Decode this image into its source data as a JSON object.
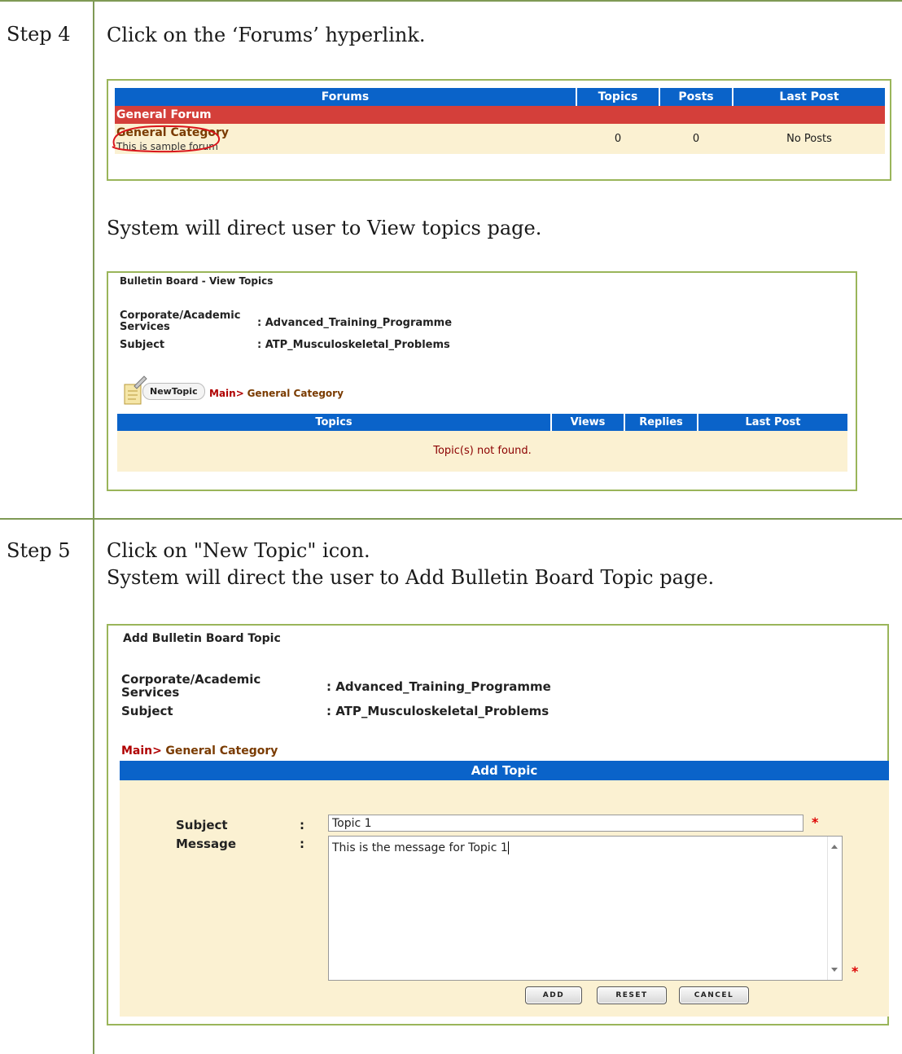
{
  "step4": {
    "label": "Step 4",
    "instruction": "Click on the ‘Forums’ hyperlink.",
    "result_text": "System will direct user to View topics page."
  },
  "forums_table": {
    "headers": [
      "Forums",
      "Topics",
      "Posts",
      "Last Post"
    ],
    "group_row": "General Forum",
    "row": {
      "name": "General Category",
      "description": "This is sample forum",
      "topics": "0",
      "posts": "0",
      "last_post": "No Posts"
    }
  },
  "view_topics": {
    "title": "Bulletin Board - View Topics",
    "meta": [
      {
        "label": "Corporate/Academic Services",
        "value": ": Advanced_Training_Programme"
      },
      {
        "label": "Subject",
        "value": ": ATP_Musculoskeletal_Problems"
      }
    ],
    "new_topic_label": "NewTopic",
    "breadcrumb_main": "Main>",
    "breadcrumb_category": "General Category",
    "headers": [
      "Topics",
      "Views",
      "Replies",
      "Last Post"
    ],
    "empty_message": "Topic(s) not found."
  },
  "step5": {
    "label": "Step 5",
    "instruction_line1": "Click on \"New Topic\" icon.",
    "instruction_line2": "System will direct the user to Add Bulletin Board Topic page."
  },
  "add_topic": {
    "title": "Add Bulletin Board Topic",
    "meta": [
      {
        "label": "Corporate/Academic Services",
        "value": ": Advanced_Training_Programme"
      },
      {
        "label": "Subject",
        "value": ": ATP_Musculoskeletal_Problems"
      }
    ],
    "breadcrumb_main": "Main>",
    "breadcrumb_category": "General Category",
    "section_header": "Add Topic",
    "subject_label": "Subject",
    "message_label": "Message",
    "colon": ":",
    "subject_value": "Topic 1",
    "message_value": "This is the message for Topic 1",
    "required_mark": "*",
    "buttons": {
      "add": "ADD",
      "reset": "RESET",
      "cancel": "CANCEL"
    }
  },
  "colors": {
    "accent_blue": "#0a63c9",
    "group_red": "#d43f3a",
    "row_beige": "#fbf1d2",
    "border_green": "#9ab55a"
  }
}
